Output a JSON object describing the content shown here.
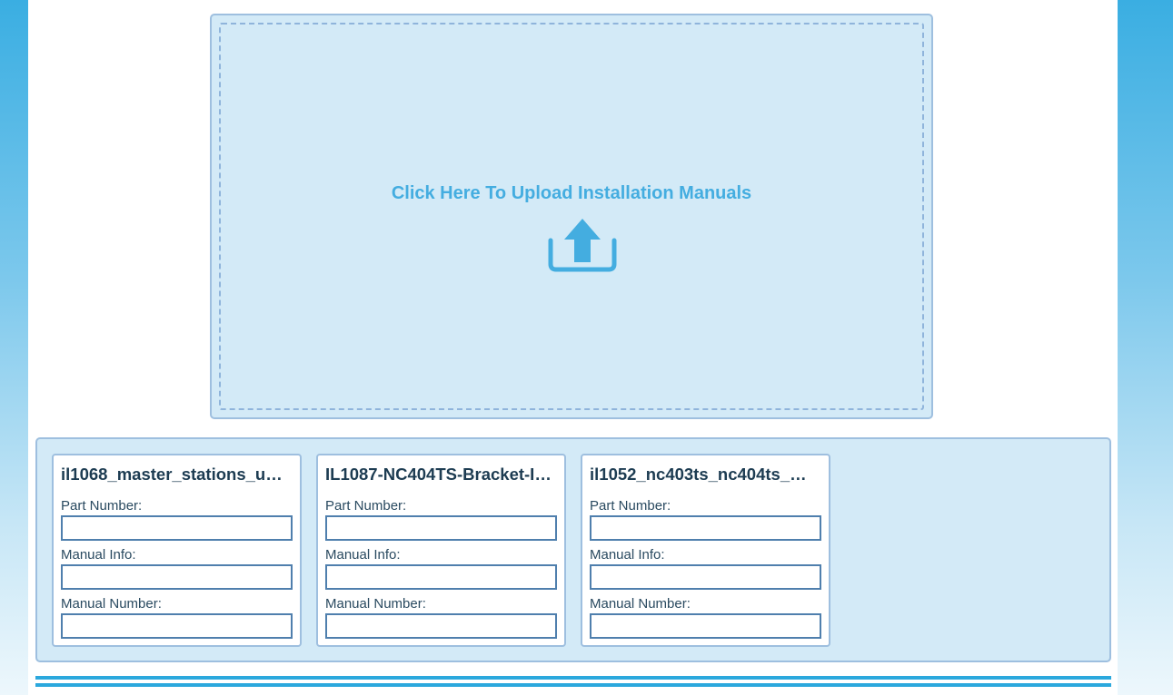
{
  "upload": {
    "label": "Click Here To Upload Installation Manuals",
    "icon": "upload-icon",
    "color": "#44ade0"
  },
  "files": [
    {
      "title": "il1068_master_stations_u…",
      "part_number_label": "Part Number:",
      "part_number_value": "",
      "manual_info_label": "Manual Info:",
      "manual_info_value": "",
      "manual_number_label": "Manual Number:",
      "manual_number_value": ""
    },
    {
      "title": "IL1087-NC404TS-Bracket-I…",
      "part_number_label": "Part Number:",
      "part_number_value": "",
      "manual_info_label": "Manual Info:",
      "manual_info_value": "",
      "manual_number_label": "Manual Number:",
      "manual_number_value": ""
    },
    {
      "title": "il1052_nc403ts_nc404ts_…",
      "part_number_label": "Part Number:",
      "part_number_value": "",
      "manual_info_label": "Manual Info:",
      "manual_info_value": "",
      "manual_number_label": "Manual Number:",
      "manual_number_value": ""
    }
  ],
  "theme": {
    "panel_bg": "#d3eaf7",
    "panel_border": "#9ebfdf",
    "input_border": "#4f7fad",
    "accent": "#2ba8dd"
  }
}
